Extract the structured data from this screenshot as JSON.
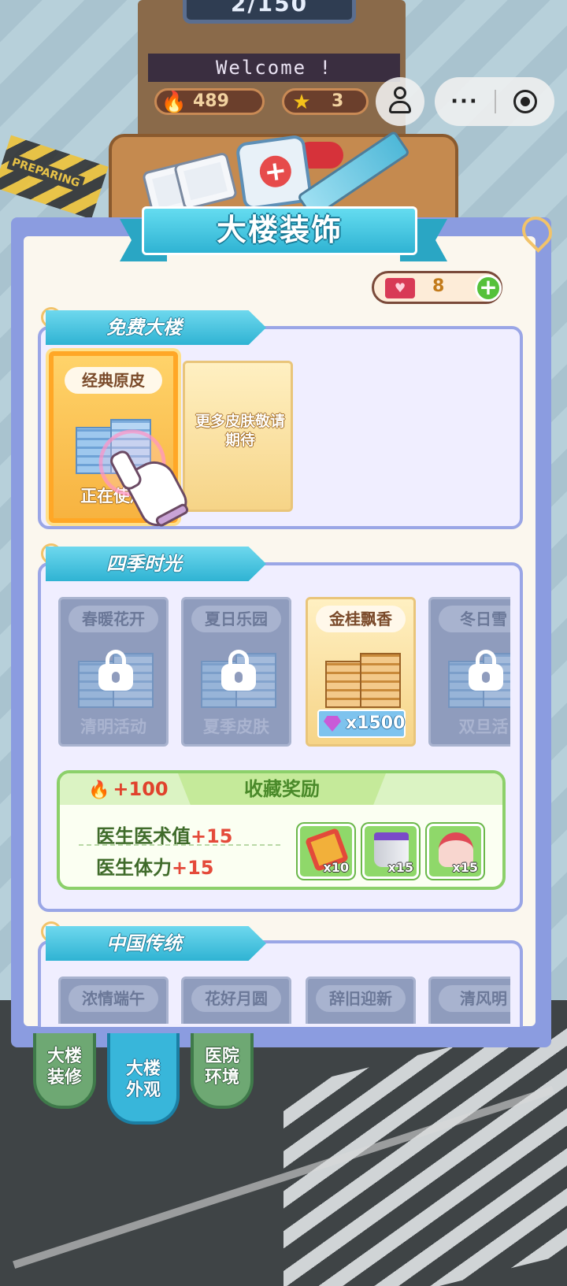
{
  "background": {
    "counter_text": "2/150",
    "welcome_text": "Welcome !",
    "fire_value": "489",
    "star_value": "3",
    "sign_text": "PREPARING"
  },
  "top_controls": {
    "more_glyph": "···"
  },
  "panel": {
    "title": "大楼装饰",
    "currency_value": "8"
  },
  "sections": [
    {
      "title": "免费大楼",
      "cards": [
        {
          "label": "经典原皮",
          "footer": "正在使用",
          "state": "selected"
        },
        {
          "label": "",
          "footer": "更多皮肤敬请期待",
          "state": "placeholder"
        }
      ]
    },
    {
      "title": "四季时光",
      "cards": [
        {
          "label": "春暖花开",
          "footer": "清明活动",
          "state": "locked"
        },
        {
          "label": "夏日乐园",
          "footer": "夏季皮肤",
          "state": "locked"
        },
        {
          "label": "金桂飘香",
          "price": "x1500",
          "state": "purchasable"
        },
        {
          "label": "冬日雪",
          "footer": "双旦活",
          "state": "locked"
        }
      ],
      "reward": {
        "title": "收藏奖励",
        "fire_bonus": "+100",
        "stats": [
          {
            "name": "医生医术值",
            "bonus": "+15"
          },
          {
            "name": "医生体力",
            "bonus": "+15"
          }
        ],
        "items": [
          {
            "icon": "medal-icon",
            "qty": "x10"
          },
          {
            "icon": "paint-bucket-icon",
            "qty": "x15"
          },
          {
            "icon": "cake-icon",
            "qty": "x15"
          }
        ]
      }
    },
    {
      "title": "中国传统",
      "cards": [
        {
          "label": "浓情端午"
        },
        {
          "label": "花好月圆"
        },
        {
          "label": "辞旧迎新"
        },
        {
          "label": "清风明"
        }
      ]
    }
  ],
  "bottom_tabs": [
    {
      "label_line1": "大楼",
      "label_line2": "装修",
      "active": false
    },
    {
      "label_line1": "大楼",
      "label_line2": "外观",
      "active": true
    },
    {
      "label_line1": "医院",
      "label_line2": "环境",
      "active": false
    }
  ],
  "colors": {
    "accent_cyan": "#2fb3d3",
    "panel_border": "#8b9ce0",
    "selected_orange": "#ffa726",
    "reward_green": "#8cd06a",
    "bonus_red": "#e44a3a"
  }
}
